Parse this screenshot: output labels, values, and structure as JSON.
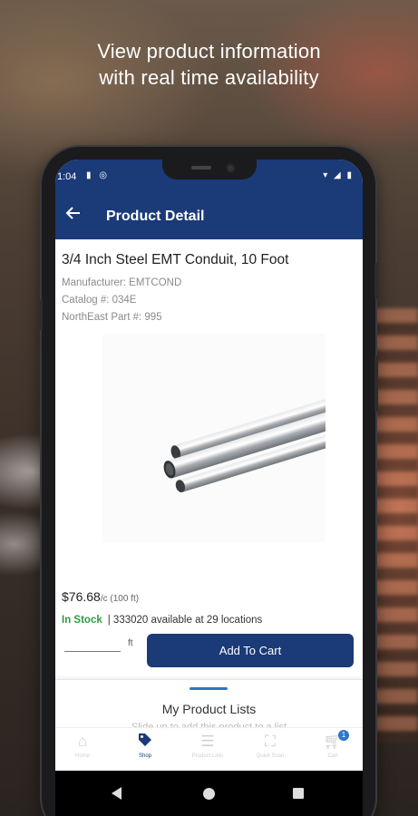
{
  "promo": {
    "headline_line1": "View product information",
    "headline_line2": "with real time availability"
  },
  "status_bar": {
    "time": "1:04"
  },
  "app_bar": {
    "title": "Product Detail",
    "back_icon": "arrow-left-icon"
  },
  "product": {
    "title": "3/4 Inch Steel EMT Conduit, 10 Foot",
    "manufacturer": "Manufacturer: EMTCOND",
    "catalog": "Catalog #: 034E",
    "part": "NorthEast Part #: 995",
    "price": "$76.68",
    "price_unit": "/c (100 ft)",
    "stock_status": "In Stock",
    "availability": "| 333020 available at 29 locations",
    "image": "steel-conduit-pipes"
  },
  "cart_form": {
    "quantity_value": "",
    "unit": "ft",
    "add_button": "Add To Cart"
  },
  "lists_sheet": {
    "title": "My Product Lists",
    "subtitle": "Slide up to add this product to a list"
  },
  "tabs": [
    {
      "label": "Home",
      "icon": "home-icon"
    },
    {
      "label": "Shop",
      "icon": "tag-icon",
      "active": true
    },
    {
      "label": "Product Lists",
      "icon": "list-icon"
    },
    {
      "label": "Quick Scan",
      "icon": "scan-icon"
    },
    {
      "label": "Cart",
      "icon": "cart-icon",
      "badge": "1"
    }
  ],
  "colors": {
    "brand": "#1a3a78",
    "in_stock": "#2e9b3f",
    "accent": "#2c77c7"
  }
}
